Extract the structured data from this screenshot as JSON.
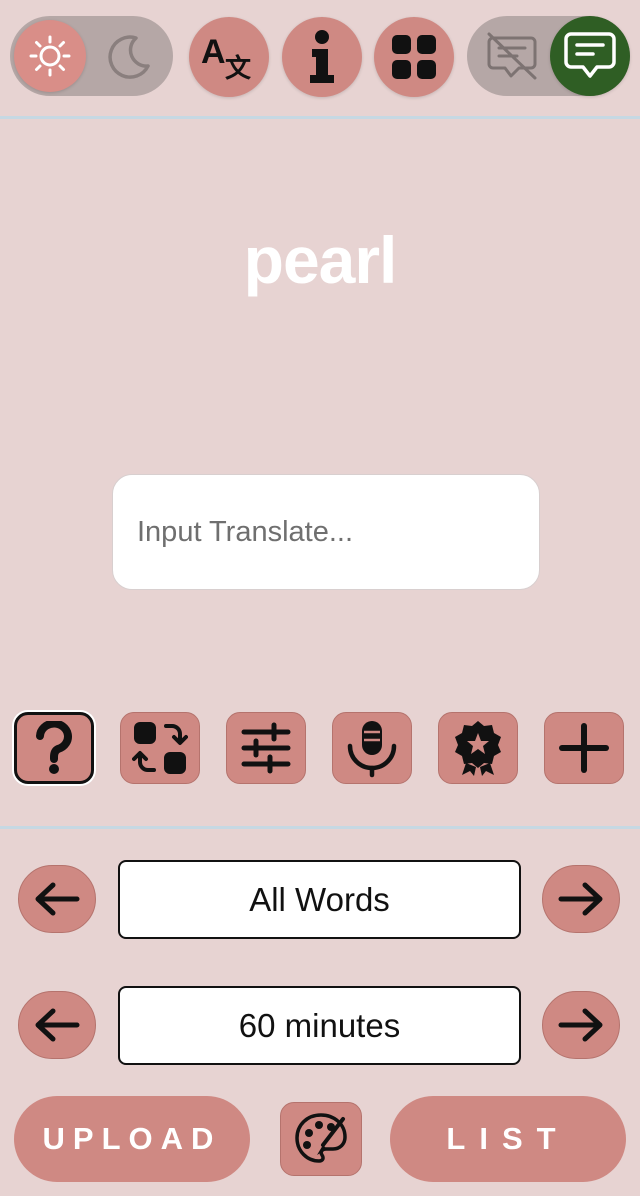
{
  "top_bar": {
    "theme_toggle": {
      "light_icon": "sun-icon",
      "dark_icon": "moon-icon"
    },
    "translate_icon": "translate-icon",
    "info_icon": "info-icon",
    "apps_icon": "apps-grid-icon",
    "chat_toggle": {
      "off_icon": "chat-off-icon",
      "on_icon": "chat-icon",
      "on_color": "#2f5e24"
    }
  },
  "card": {
    "word": "pearl",
    "input_placeholder": "Input Translate...",
    "input_value": ""
  },
  "tools": [
    {
      "name": "help",
      "icon": "question-icon",
      "active": true
    },
    {
      "name": "swap",
      "icon": "swap-icon",
      "active": false
    },
    {
      "name": "settings",
      "icon": "sliders-icon",
      "active": false
    },
    {
      "name": "voice",
      "icon": "microphone-icon",
      "active": false
    },
    {
      "name": "badge",
      "icon": "award-icon",
      "active": false
    },
    {
      "name": "add",
      "icon": "plus-icon",
      "active": false
    }
  ],
  "filters": {
    "word_set": "All Words",
    "duration": "60 minutes"
  },
  "bottom": {
    "upload_label": "UPLOAD",
    "list_label": "LIST",
    "palette_icon": "palette-icon"
  },
  "colors": {
    "background": "#e7d3d2",
    "accent": "#cf8983",
    "divider": "#c6d8e3",
    "chat_active": "#2f5e24"
  }
}
